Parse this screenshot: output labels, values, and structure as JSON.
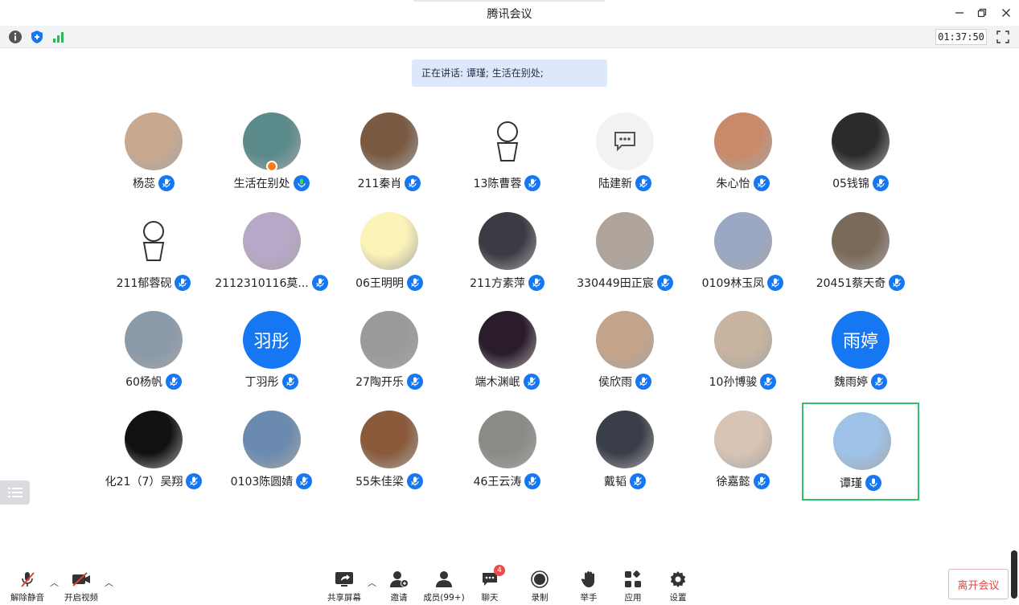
{
  "window": {
    "title": "腾讯会议"
  },
  "infobar": {
    "clock": "01:37:50"
  },
  "speaking_banner": "正在讲话: 谭瑾; 生活在别处;",
  "participants": [
    {
      "name": "杨蕊",
      "avatar": "photo-girl",
      "avatar_color": "#c9a88e"
    },
    {
      "name": "生活在别处",
      "avatar": "photo-water",
      "avatar_color": "#5a8a8a",
      "host": true,
      "mic_active": true
    },
    {
      "name": "211秦肖",
      "avatar": "photo-girl-flower",
      "avatar_color": "#7a5a42"
    },
    {
      "name": "13陈曹蓉",
      "avatar": "sketch-boy",
      "avatar_color": "#ffffff"
    },
    {
      "name": "陆建新",
      "avatar": "chat-bubble",
      "avatar_color": "#f1f2f4"
    },
    {
      "name": "朱心怡",
      "avatar": "photo-food",
      "avatar_color": "#c98a6a"
    },
    {
      "name": "05钱锦",
      "avatar": "photo-man-dark",
      "avatar_color": "#2b2b2b"
    },
    {
      "name": "211郁蓉砚",
      "avatar": "sketch-rabbit",
      "avatar_color": "#ffffff"
    },
    {
      "name": "2112310116莫...",
      "avatar": "photo-girl-purple",
      "avatar_color": "#b8a8c8"
    },
    {
      "name": "06王明明",
      "avatar": "photo-yellow-card",
      "avatar_color": "#fbf3b8"
    },
    {
      "name": "211方素萍",
      "avatar": "photo-girl-dark",
      "avatar_color": "#3b3b44"
    },
    {
      "name": "330449田正宸",
      "avatar": "photo-cat",
      "avatar_color": "#b0a49a"
    },
    {
      "name": "0109林玉凤",
      "avatar": "photo-girl-sky",
      "avatar_color": "#9aa8c4"
    },
    {
      "name": "20451蔡天奇",
      "avatar": "photo-boy",
      "avatar_color": "#7a6a5a"
    },
    {
      "name": "60杨帆",
      "avatar": "cartoon-tom",
      "avatar_color": "#8a9aa8"
    },
    {
      "name": "丁羽彤",
      "avatar": "text",
      "avatar_text": "羽彤",
      "avatar_color": "#1677f2"
    },
    {
      "name": "27陶开乐",
      "avatar": "anime-boy",
      "avatar_color": "#9a9a9a"
    },
    {
      "name": "端木渊岷",
      "avatar": "anime-dark",
      "avatar_color": "#2a1c2a"
    },
    {
      "name": "侯欣雨",
      "avatar": "photo-girl-warm",
      "avatar_color": "#c4a48a"
    },
    {
      "name": "10孙博骏",
      "avatar": "photo-girl-cup",
      "avatar_color": "#c8b4a0"
    },
    {
      "name": "魏雨婷",
      "avatar": "text",
      "avatar_text": "雨婷",
      "avatar_color": "#1677f2"
    },
    {
      "name": "化21（7）吴翔",
      "avatar": "astronaut",
      "avatar_color": "#111111"
    },
    {
      "name": "0103陈圆婧",
      "avatar": "anime-conan",
      "avatar_color": "#6a8ab0"
    },
    {
      "name": "55朱佳梁",
      "avatar": "photo-cat-brown",
      "avatar_color": "#8a5a3a"
    },
    {
      "name": "46王云涛",
      "avatar": "photo-shoes",
      "avatar_color": "#8a8a86"
    },
    {
      "name": "戴韬",
      "avatar": "anime-gray",
      "avatar_color": "#3a3e48"
    },
    {
      "name": "徐嘉懿",
      "avatar": "photo-woman-suit",
      "avatar_color": "#d8c4b4"
    },
    {
      "name": "谭瑾",
      "avatar": "photo-sky-cloud",
      "avatar_color": "#9ec2e8",
      "active": true,
      "mic_active": true
    }
  ],
  "toolbar": {
    "mute": "解除静音",
    "video": "开启视频",
    "share": "共享屏幕",
    "invite": "邀请",
    "members": "成员(99+)",
    "chat": "聊天",
    "chat_badge": "4",
    "record": "录制",
    "raise_hand": "举手",
    "apps": "应用",
    "settings": "设置",
    "leave": "离开会议"
  },
  "colors": {
    "accent": "#1677f2",
    "active_border": "#2fc26a",
    "leave_text": "#e54545"
  }
}
